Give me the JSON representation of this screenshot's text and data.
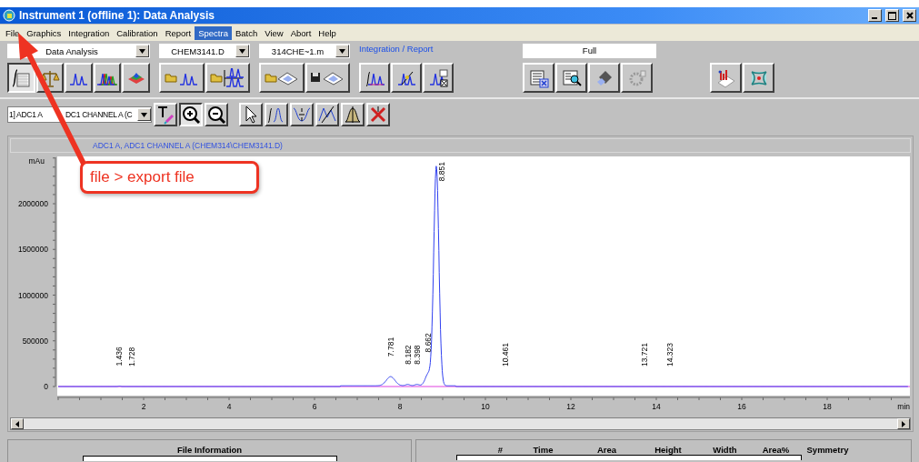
{
  "window": {
    "title": "Instrument 1 (offline 1): Data Analysis"
  },
  "menu": [
    {
      "label": "File",
      "selected": false
    },
    {
      "label": "Graphics",
      "selected": false
    },
    {
      "label": "Integration",
      "selected": false
    },
    {
      "label": "Calibration",
      "selected": false
    },
    {
      "label": "Report",
      "selected": false
    },
    {
      "label": "Spectra",
      "selected": true
    },
    {
      "label": "Batch",
      "selected": false
    },
    {
      "label": "View",
      "selected": false
    },
    {
      "label": "Abort",
      "selected": false
    },
    {
      "label": "Help",
      "selected": false
    }
  ],
  "toolbar": {
    "view_select": "Data Analysis",
    "data_file": "CHEM3141.D",
    "method_file": "314CHE~1.m",
    "task_link": "Integration / Report",
    "report_style": "Full",
    "view_buttons": [
      {
        "selected": true
      },
      {
        "selected": false
      },
      {
        "selected": false
      },
      {
        "selected": false
      },
      {
        "selected": false
      }
    ]
  },
  "signal_toolbar": {
    "signal_select": [
      "1] ADC1 A",
      "DC1 CHANNEL A (C"
    ],
    "tools": [
      {
        "selected": false
      },
      {
        "selected": true
      },
      {
        "selected": false
      },
      {
        "selected": false
      },
      {
        "selected": false
      },
      {
        "selected": false
      },
      {
        "selected": false
      },
      {
        "selected": false
      },
      {
        "selected": false
      }
    ]
  },
  "chart": {
    "title": "ADC1 A, ADC1 CHANNEL A (CHEM314\\CHEM3141.D)",
    "y_unit": "mAu",
    "y_ticks": [
      "2000000",
      "1500000",
      "1000000",
      "500000",
      "0"
    ],
    "x_ticks": [
      "2",
      "4",
      "6",
      "8",
      "10",
      "12",
      "14",
      "16",
      "18"
    ],
    "x_unit": "min",
    "peaks": [
      "1.436",
      "1.728",
      "7.781",
      "8.182",
      "8.398",
      "8.662",
      "8.851",
      "10.461",
      "13.721",
      "14.323"
    ]
  },
  "file_info": {
    "title": "File Information"
  },
  "peak_table": {
    "columns": [
      "#",
      "Time",
      "Area",
      "Height",
      "Width",
      "Area%",
      "Symmetry"
    ]
  },
  "annotation": {
    "text": "file > export file"
  }
}
